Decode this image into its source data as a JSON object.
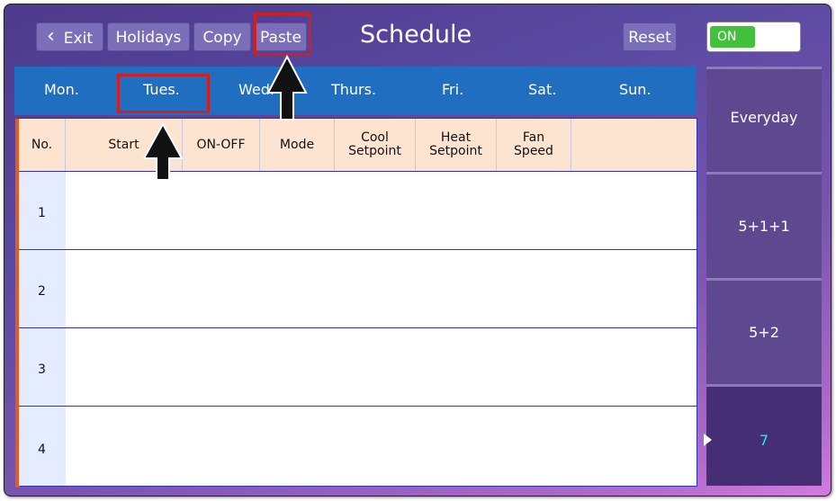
{
  "toolbar": {
    "exit_label": "Exit",
    "holidays_label": "Holidays",
    "copy_label": "Copy",
    "paste_label": "Paste",
    "title": "Schedule",
    "reset_label": "Reset",
    "toggle_label": "ON"
  },
  "days": [
    "Mon.",
    "Tues.",
    "Wed.",
    "Thurs.",
    "Fri.",
    "Sat.",
    "Sun."
  ],
  "table": {
    "headers": {
      "no": "No.",
      "start": "Start",
      "onoff": "ON-OFF",
      "mode": "Mode",
      "cool_1": "Cool",
      "cool_2": "Setpoint",
      "heat_1": "Heat",
      "heat_2": "Setpoint",
      "fan_1": "Fan",
      "fan_2": "Speed"
    },
    "rows": [
      "1",
      "2",
      "3",
      "4"
    ]
  },
  "modes": [
    "Everyday",
    "5+1+1",
    "5+2",
    "7"
  ],
  "colors": {
    "highlight": "#d21e1e",
    "day_tabs": "#1f6ebf",
    "header_row": "#fde4d0",
    "toggle_on": "#42c23c",
    "selected_mode_text": "#2ee6f0"
  }
}
